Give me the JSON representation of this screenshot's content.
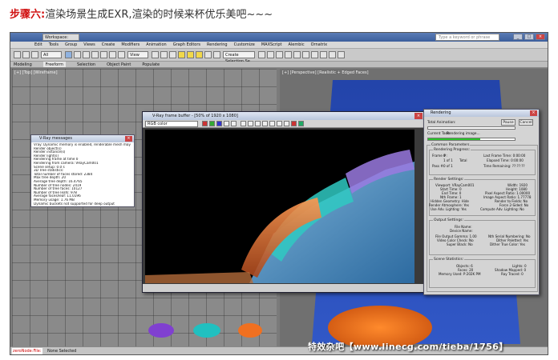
{
  "caption": {
    "label": "步骤六:",
    "text": "渲染场景生成EXR,渲染的时候来杯优乐美吧~~~"
  },
  "app": {
    "workspace": "Workspace: Default",
    "title_search": "Type a keyword or phrase",
    "menu": [
      "Edit",
      "Tools",
      "Group",
      "Views",
      "Create",
      "Modifiers",
      "Animation",
      "Graph Editors",
      "Rendering",
      "Customize",
      "MAXScript",
      "Alembic",
      "Ornatrix"
    ],
    "toolbar": {
      "filter_value": "All",
      "view_value": "View",
      "selection_set": "Create Selection Se"
    },
    "ribbon_tabs": [
      "Modeling",
      "Freeform",
      "Selection",
      "Object Paint",
      "Populate"
    ],
    "viewports": {
      "left_label": "[+] [Top] [Wireframe]",
      "right_label": "[+] [Perspective] [Realistic + Edged Faces]"
    },
    "status": {
      "script_text": "zeroNode:File: Dy",
      "selection": "None Selected"
    }
  },
  "vray_messages": {
    "title": "V-Ray messages",
    "lines": [
      "Vray: Dynamic memory is enabled, renderable mesh may have high rendering time",
      "Render object(s)",
      "Render instance(s)",
      "Render light(s)",
      "Rendering frame at time 0",
      "Rendering from camera: VRayCam001",
      "Scene setup: 0.0 s",
      "3D Tree statistics:",
      "Total number of faces stored: 2384",
      "Max tree depth: 20",
      "Average tree depth: 16.4765",
      "Number of tree nodes: 2419",
      "Number of tree faces: 10127",
      "Number of tree leafs: 978",
      "Average faces/leaf: 11.0196",
      "Memory usage: 1.76 MB",
      "Dynamic buckets not supported for deep output"
    ]
  },
  "frame_buffer": {
    "title": "V-Ray frame buffer - [50% of 1920 x 1080]",
    "channel": "RGB color"
  },
  "rendering_window": {
    "title": "Rendering",
    "pause_label": "Pause",
    "cancel_label": "Cancel",
    "total_animation_label": "Total Animation:",
    "current_task_label": "Current Task:",
    "current_task_value": "Rendering image...",
    "progress_fraction": 0.6,
    "common_parameters_header": "Common Parameters",
    "rendering_progress_header": "Rendering Progress:",
    "frame_label": "Frame #:",
    "frame_value": "0",
    "of_label": "1 of 1",
    "total_label": "Total",
    "pass_label": "Pass #:",
    "pass_value": "0 of 1",
    "last_frame_time": "Last Frame Time: 0:00:00",
    "elapsed_time": "Elapsed Time: 0:00:00",
    "time_remaining": "Time Remaining: ??:??:??",
    "render_settings_header": "Render Settings:",
    "viewport": "Viewport: VRayCam001",
    "width": "Width: 1920",
    "start_time": "Start Time: 0",
    "height": "Height: 1080",
    "end_time": "End Time: 0",
    "pixel_aspect": "Pixel Aspect Ratio: 1.00000",
    "nth_frame": "Nth Frame: 1",
    "image_aspect": "Image Aspect Ratio: 1.77778",
    "hidden_geometry": "Hidden Geometry: Hide",
    "render_to_fields": "Render to Fields: No",
    "render_atmosphere": "Render Atmosphere: Yes",
    "force_2sided": "Force 2-Sided: No",
    "use_adv_lighting": "Use Adv. Lighting: Yes",
    "compute_adv_lighting": "Compute Adv. Lighting: No",
    "output_settings_header": "Output Settings:",
    "file_name": "File Name:",
    "device_name": "Device Name:",
    "file_output_gamma": "File Output Gamma: 1.00",
    "nth_serial": "Nth Serial Numbering: No",
    "video_color_check": "Video Color Check: No",
    "dither_paletted": "Dither Paletted: Yes",
    "super_black": "Super Black: No",
    "dither_true_color": "Dither True Color: Yes",
    "scene_stats_header": "Scene Statistics:",
    "objects": "Objects: 6",
    "lights": "Lights: 0",
    "faces": "Faces: 20",
    "shadow_mapped": "Shadow Mapped: 0",
    "memory_used": "Memory Used: P:202K PM",
    "ray_traced": "Ray Traced: 0"
  },
  "watermark": "特效杂吧【www.linecg.com/tieba/1756】"
}
